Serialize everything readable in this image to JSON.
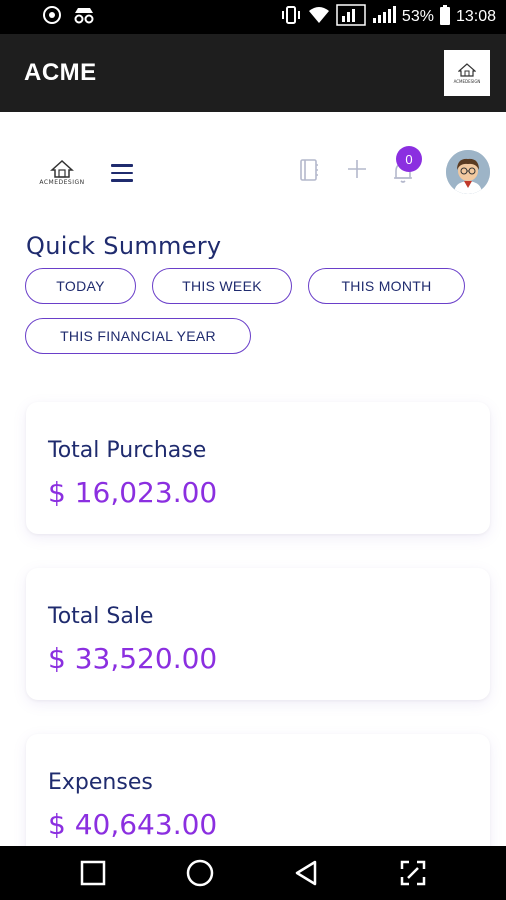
{
  "status_bar": {
    "battery": "53%",
    "time": "13:08"
  },
  "app_bar": {
    "title": "ACME",
    "logo_text": "ACMEDESIGN"
  },
  "header": {
    "brand_text": "ACMEDESIGN",
    "notification_count": "0"
  },
  "quick_summary": {
    "title": "Quick Summery",
    "filters": [
      "TODAY",
      "THIS WEEK",
      "THIS MONTH",
      "THIS FINANCIAL YEAR"
    ]
  },
  "cards": [
    {
      "label": "Total Purchase",
      "value": "$ 16,023.00"
    },
    {
      "label": "Total Sale",
      "value": "$ 33,520.00"
    },
    {
      "label": "Expenses",
      "value": "$ 40,643.00"
    }
  ],
  "colors": {
    "primary_text": "#1f2b6e",
    "accent": "#8b2fe0",
    "pill_border": "#6a3fc9",
    "app_bar": "#1e1e1e"
  }
}
